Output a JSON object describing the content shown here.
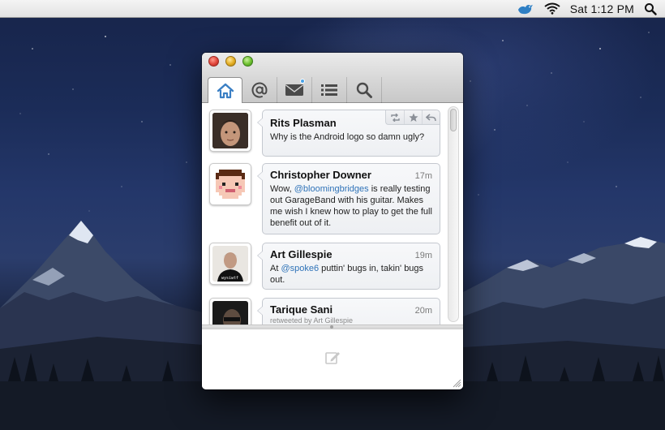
{
  "menubar": {
    "clock": "Sat 1:12 PM",
    "icons": [
      "twitter-bird-icon",
      "wifi-icon",
      "spotlight-search-icon"
    ]
  },
  "window": {
    "tabs": [
      {
        "id": "home",
        "icon": "home-icon",
        "active": true
      },
      {
        "id": "mentions",
        "icon": "at-sign-icon",
        "active": false
      },
      {
        "id": "messages",
        "icon": "envelope-icon",
        "active": false,
        "badge": true
      },
      {
        "id": "lists",
        "icon": "list-icon",
        "active": false
      },
      {
        "id": "search",
        "icon": "search-icon",
        "active": false
      }
    ],
    "tweets": [
      {
        "name": "Rits Plasman",
        "time": "",
        "text_parts": [
          "Why is the Android logo so damn ugly?"
        ],
        "actions": [
          "retweet-icon",
          "favorite-star-icon",
          "reply-icon"
        ]
      },
      {
        "name": "Christopher Downer",
        "time": "17m",
        "text_before": "Wow, ",
        "mention": "@bloomingbridges",
        "text_after": " is really testing out GarageBand with his guitar. Makes me wish I knew how to play to get the full benefit out of it."
      },
      {
        "name": "Art Gillespie",
        "time": "19m",
        "text_before": "At ",
        "mention": "@spoke6",
        "text_after": " puttin' bugs in, takin' bugs out."
      },
      {
        "name": "Tarique Sani",
        "time": "20m",
        "retweeted_by": "retweeted by Art Gillespie"
      }
    ]
  },
  "colors": {
    "mention": "#2f73b8",
    "tab_active_icon": "#3a7fc4",
    "badge": "#4aa3e8"
  }
}
